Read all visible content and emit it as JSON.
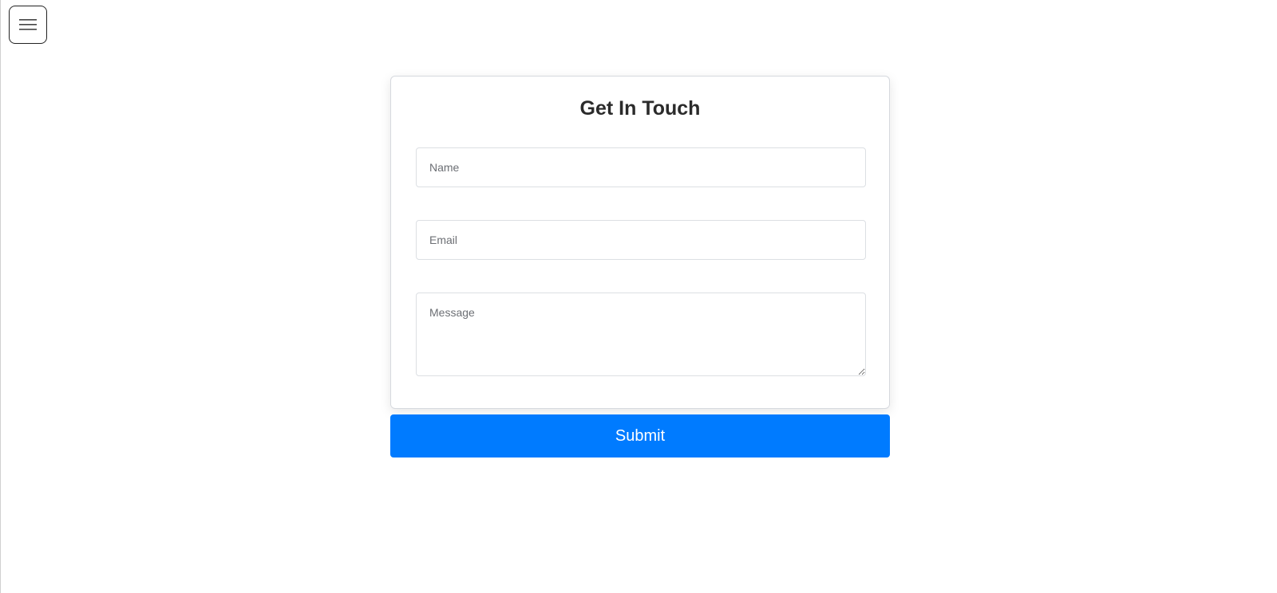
{
  "header": {
    "menu_icon": "hamburger-icon"
  },
  "form": {
    "title": "Get In Touch",
    "name_placeholder": "Name",
    "email_placeholder": "Email",
    "message_placeholder": "Message",
    "submit_label": "Submit"
  },
  "colors": {
    "accent": "#007bff",
    "title_text": "#2b2b2b",
    "border": "#dcdfe3"
  }
}
